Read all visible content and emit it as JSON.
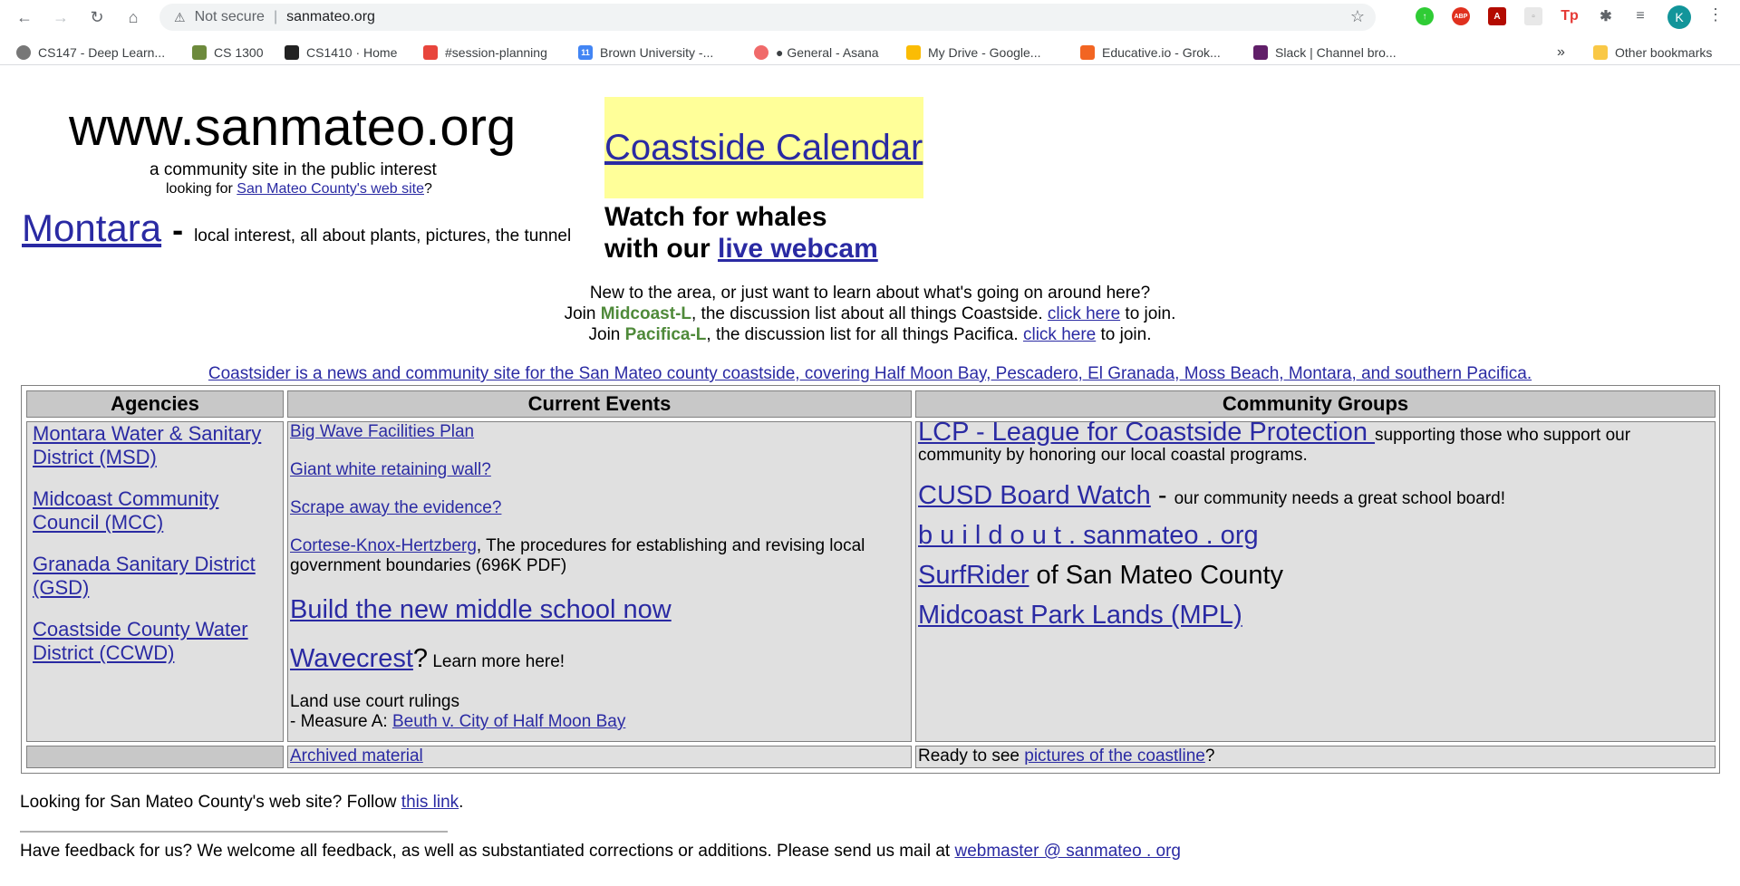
{
  "browser": {
    "not_secure": "Not secure",
    "url": "sanmateo.org",
    "profile_initial": "K",
    "bookmarks": [
      "CS147 - Deep Learn...",
      "CS 1300",
      "CS1410 · Home",
      "#session-planning",
      "Brown University -...",
      "● General - Asana",
      "My Drive - Google...",
      "Educative.io - Grok...",
      "Slack | Channel bro..."
    ],
    "more_bookmarks": "»",
    "other_bookmarks": "Other bookmarks"
  },
  "header": {
    "site_title": "www.sanmateo.org",
    "tagline": "a community site in the public interest",
    "looking_prefix": "looking for ",
    "looking_link": "San Mateo County's web site",
    "looking_suffix": "?"
  },
  "montara": {
    "link": "Montara",
    "dash": "-",
    "desc": "local interest, all about plants, pictures, the tunnel"
  },
  "calendar": {
    "link": "Coastside Calendar"
  },
  "whales": {
    "line1": "Watch for whales",
    "line2_prefix": "with our ",
    "line2_link": "live webcam"
  },
  "intro": {
    "line1": "New to the area, or just want to learn about what's going on around here?",
    "line2_prefix": "Join ",
    "line2_list": "Midcoast-L",
    "line2_mid": ", the discussion list about all things Coastside. ",
    "line2_link": "click here",
    "line2_suffix": " to join.",
    "line3_prefix": "Join ",
    "line3_list": "Pacifica-L",
    "line3_mid": ", the discussion list for all things Pacifica. ",
    "line3_link": "click here",
    "line3_suffix": " to join."
  },
  "coastsider": "Coastsider is a news and community site for the San Mateo county coastside, covering Half Moon Bay, Pescadero, El Granada, Moss Beach, Montara, and southern Pacifica.",
  "table": {
    "headers": [
      "Agencies",
      "Current Events",
      "Community Groups"
    ],
    "agencies": [
      "Montara Water & Sanitary District (MSD)",
      "Midcoast Community Council (MCC)",
      "Granada Sanitary District (GSD)",
      "Coastside County Water District (CCWD)"
    ],
    "events": {
      "e1": "Big Wave Facilities Plan",
      "e2": "Giant white retaining wall?",
      "e3": "Scrape away the evidence?",
      "e4_link": "Cortese-Knox-Hertzberg",
      "e4_text": ", The procedures for establishing and revising local government boundaries (696K PDF)",
      "e5": "Build the new middle school now",
      "e6_link": "Wavecrest",
      "e6_q": "?",
      "e6_text": " Learn more here!",
      "e7_line1": "Land use court rulings",
      "e7_prefix": "- Measure A: ",
      "e7_link": "Beuth v. City of Half Moon Bay"
    },
    "groups": {
      "g1_link": "LCP - League for Coastside Protection ",
      "g1_text": "supporting those who support our community by honoring our local coastal programs.",
      "g2_link": "CUSD Board Watch",
      "g2_dash": " - ",
      "g2_text": "our community needs a great school board!",
      "g3_link": "b u i l d o u t . sanmateo . org",
      "g4_link": "SurfRider",
      "g4_text": " of San Mateo County",
      "g5_link": "Midcoast Park Lands (MPL)"
    },
    "footer_events": "Archived material",
    "footer_groups_prefix": "Ready to see ",
    "footer_groups_link": "pictures of the coastline",
    "footer_groups_suffix": "?"
  },
  "footer": {
    "looking_prefix": "Looking for San Mateo County's web site? Follow ",
    "looking_link": "this link",
    "looking_suffix": ".",
    "feedback_prefix": "Have feedback for us? We welcome all feedback, as well as substantiated corrections or additions. Please send us mail at ",
    "feedback_link": "webmaster @ sanmateo . org"
  }
}
